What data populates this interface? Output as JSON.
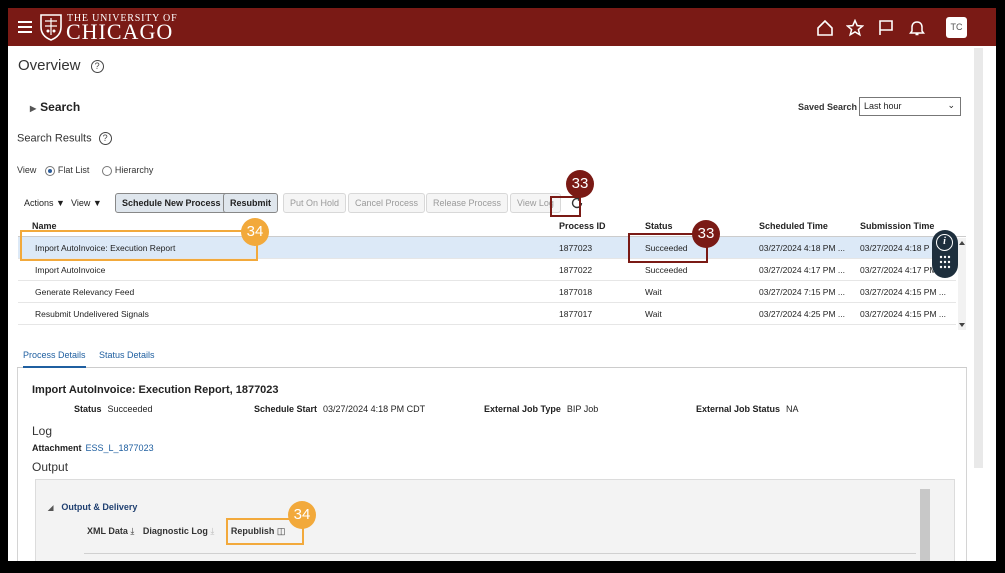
{
  "header": {
    "university_top": "THE UNIVERSITY OF",
    "university_main": "CHICAGO",
    "avatar_initials": "TC",
    "icons": [
      "home-icon",
      "star-icon",
      "flag-icon",
      "bell-icon"
    ],
    "brand_color": "#7a1a15"
  },
  "page": {
    "title": "Overview",
    "help_glyph": "?"
  },
  "search": {
    "label": "Search",
    "saved_search_label": "Saved Search",
    "saved_search_value": "Last hour"
  },
  "results": {
    "label": "Search Results",
    "view_label": "View",
    "view_options": [
      "Flat List",
      "Hierarchy"
    ],
    "view_selected": "Flat List"
  },
  "toolbar": {
    "actions": "Actions",
    "view": "View",
    "schedule_new_process": "Schedule New Process",
    "resubmit": "Resubmit",
    "put_on_hold": "Put On Hold",
    "cancel_process": "Cancel Process",
    "release_process": "Release Process",
    "view_log": "View Log"
  },
  "grid": {
    "columns": [
      "Name",
      "Process ID",
      "Status",
      "Scheduled Time",
      "Submission Time"
    ],
    "rows": [
      {
        "name": "Import AutoInvoice: Execution Report",
        "id": "1877023",
        "status": "Succeeded",
        "scheduled": "03/27/2024 4:18 PM ...",
        "submission": "03/27/2024 4:18 P"
      },
      {
        "name": "Import AutoInvoice",
        "id": "1877022",
        "status": "Succeeded",
        "scheduled": "03/27/2024 4:17 PM ...",
        "submission": "03/27/2024 4:17 PM ..."
      },
      {
        "name": "Generate Relevancy Feed",
        "id": "1877018",
        "status": "Wait",
        "scheduled": "03/27/2024 7:15 PM ...",
        "submission": "03/27/2024 4:15 PM ..."
      },
      {
        "name": "Resubmit Undelivered Signals",
        "id": "1877017",
        "status": "Wait",
        "scheduled": "03/27/2024 4:25 PM ...",
        "submission": "03/27/2024 4:15 PM ..."
      }
    ]
  },
  "tabs": [
    "Process Details",
    "Status Details"
  ],
  "details": {
    "title": "Import AutoInvoice: Execution Report, 1877023",
    "status_label": "Status",
    "status_value": "Succeeded",
    "schedule_start_label": "Schedule Start",
    "schedule_start_value": "03/27/2024 4:18 PM CDT",
    "external_job_type_label": "External Job Type",
    "external_job_type_value": "BIP Job",
    "external_job_status_label": "External Job Status",
    "external_job_status_value": "NA",
    "log_heading": "Log",
    "attachment_label": "Attachment",
    "attachment_value": "ESS_L_1877023",
    "output_heading": "Output",
    "output_delivery": "Output & Delivery",
    "xml_data": "XML Data",
    "diagnostic_log": "Diagnostic Log",
    "republish": "Republish"
  },
  "annotations": {
    "badge_refresh": "33",
    "badge_status": "33",
    "badge_row": "34",
    "badge_republish": "34",
    "red_color": "#7a1a15",
    "gold_color": "#f2a93b"
  }
}
